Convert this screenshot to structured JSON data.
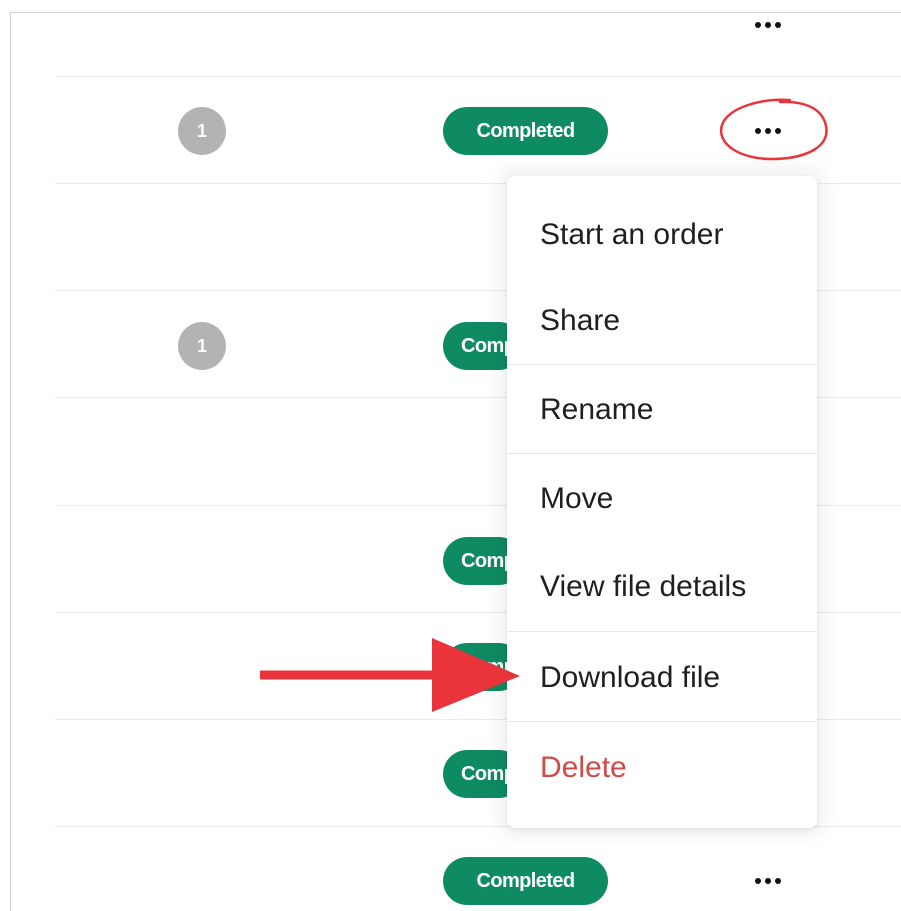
{
  "rows": [
    {
      "count": "",
      "status": "",
      "has_menu_button": true
    },
    {
      "count": "1",
      "status": "Completed",
      "has_menu_button": true
    },
    {
      "count": "",
      "status": "",
      "has_menu_button": false
    },
    {
      "count": "1",
      "status": "Completed",
      "has_menu_button": false
    },
    {
      "count": "",
      "status": "",
      "has_menu_button": false
    },
    {
      "count": "",
      "status": "Completed",
      "has_menu_button": false
    },
    {
      "count": "",
      "status": "Completed",
      "has_menu_button": false
    },
    {
      "count": "",
      "status": "Completed",
      "has_menu_button": false
    },
    {
      "count": "",
      "status": "Completed",
      "has_menu_button": true
    }
  ],
  "menu": {
    "items": [
      {
        "label": "Start an order"
      },
      {
        "label": "Share"
      },
      {
        "label": "Rename"
      },
      {
        "label": "Move"
      },
      {
        "label": "View file details"
      },
      {
        "label": "Download file"
      },
      {
        "label": "Delete",
        "danger": true
      }
    ]
  },
  "annotations": {
    "circle_color": "#e8343a",
    "arrow_color": "#e8343a",
    "circled_target": "more-options-button",
    "arrow_target": "Download file"
  },
  "colors": {
    "status_completed": "#0f8b63",
    "count_badge": "#b3b3b3",
    "danger_text": "#d04a4a"
  }
}
